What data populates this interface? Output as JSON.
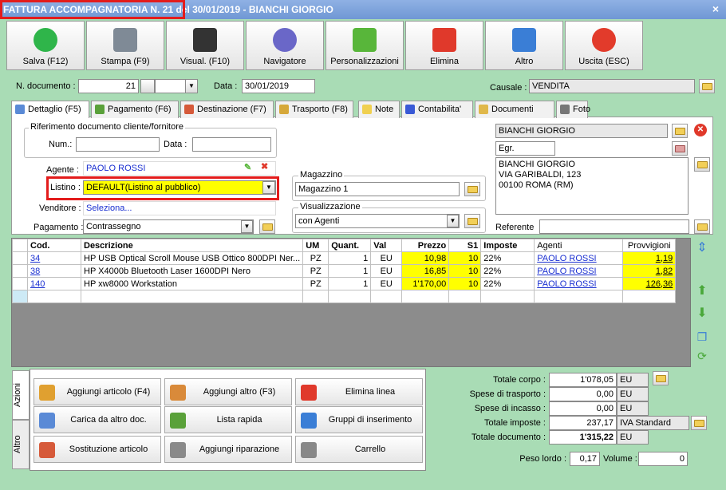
{
  "window": {
    "title": "FATTURA ACCOMPAGNATORIA N. 21 del 30/01/2019 - BIANCHI GIORGIO",
    "close": "×"
  },
  "toolbar": [
    {
      "label": "Salva (F12)",
      "icon": "check-icon",
      "color": "#2fb54a"
    },
    {
      "label": "Stampa (F9)",
      "icon": "printer-icon",
      "color": "#7f8a96"
    },
    {
      "label": "Visual. (F10)",
      "icon": "magic-wand-icon",
      "color": "#333333"
    },
    {
      "label": "Navigatore",
      "icon": "compass-icon",
      "color": "#6a67c8"
    },
    {
      "label": "Personalizzazioni",
      "icon": "puzzle-icon",
      "color": "#58b63a"
    },
    {
      "label": "Elimina",
      "icon": "delete-x-icon",
      "color": "#e0392b"
    },
    {
      "label": "Altro",
      "icon": "magnifier-icon",
      "color": "#3a7ed6"
    },
    {
      "label": "Uscita (ESC)",
      "icon": "exit-icon",
      "color": "#e23b2b"
    }
  ],
  "header": {
    "doc_label": "N. documento :",
    "doc_number": "21",
    "date_label": "Data :",
    "date": "30/01/2019",
    "causale_label": "Causale :",
    "causale": "VENDITA"
  },
  "tabs": [
    {
      "label": "Dettaglio (F5)",
      "icon": "detail-icon",
      "color": "#5a8ad6"
    },
    {
      "label": "Pagamento (F6)",
      "icon": "payment-icon",
      "color": "#5aa13a"
    },
    {
      "label": "Destinazione (F7)",
      "icon": "destination-icon",
      "color": "#d65a3a"
    },
    {
      "label": "Trasporto (F8)",
      "icon": "truck-icon",
      "color": "#d6a83a"
    },
    {
      "label": "Note",
      "icon": "note-icon",
      "color": "#f0d050"
    },
    {
      "label": "Contabilita'",
      "icon": "book-icon",
      "color": "#3a5ad6"
    },
    {
      "label": "Documenti",
      "icon": "documents-icon",
      "color": "#e0b84a"
    },
    {
      "label": "Foto",
      "icon": "camera-icon",
      "color": "#777777"
    }
  ],
  "riferimento": {
    "title": "Riferimento documento cliente/fornitore",
    "num_label": "Num.:",
    "data_label": "Data :"
  },
  "agente": {
    "label": "Agente :",
    "value": "PAOLO ROSSI"
  },
  "listino": {
    "label": "Listino :",
    "value": "DEFAULT(Listino al pubblico)"
  },
  "venditore": {
    "label": "Venditore :",
    "value": "Seleziona..."
  },
  "pagamento": {
    "label": "Pagamento :",
    "value": "Contrassegno"
  },
  "magazzino": {
    "title": "Magazzino",
    "value": "Magazzino 1"
  },
  "visualizzazione": {
    "title": "Visualizzazione",
    "value": "con Agenti"
  },
  "cliente": {
    "name": "BIANCHI GIORGIO",
    "code": "Egr.",
    "address": [
      "BIANCHI GIORGIO",
      "VIA GARIBALDI, 123",
      "00100 ROMA (RM)"
    ],
    "referente_label": "Referente"
  },
  "grid": {
    "columns": [
      "Cod.",
      "Descrizione",
      "UM",
      "Quant.",
      "Val",
      "Prezzo",
      "S1",
      "Imposte",
      "Agenti",
      "Provvigioni"
    ],
    "rows": [
      [
        "34",
        "HP USB Optical Scroll Mouse USB Ottico 800DPI Ner...",
        "PZ",
        "1",
        "EU",
        "10,98",
        "10",
        "22%",
        "PAOLO ROSSI",
        "1,19"
      ],
      [
        "38",
        "HP X4000b Bluetooth Laser 1600DPI Nero",
        "PZ",
        "1",
        "EU",
        "16,85",
        "10",
        "22%",
        "PAOLO ROSSI",
        "1,82"
      ],
      [
        "140",
        "HP xw8000 Workstation",
        "PZ",
        "1",
        "EU",
        "1'170,00",
        "10",
        "22%",
        "PAOLO ROSSI",
        "126,36"
      ]
    ]
  },
  "actions": {
    "vtabs": [
      "Azioni",
      "Altro"
    ],
    "buttons": [
      {
        "label": "Aggiungi articolo (F4)",
        "icon": "add-article-icon",
        "color": "#e0a030"
      },
      {
        "label": "Aggiungi altro (F3)",
        "icon": "add-other-icon",
        "color": "#d98a3a"
      },
      {
        "label": "Elimina linea",
        "icon": "delete-line-icon",
        "color": "#e0392b"
      },
      {
        "label": "Carica da altro doc.",
        "icon": "load-doc-icon",
        "color": "#5a8ad6"
      },
      {
        "label": "Lista rapida",
        "icon": "quick-list-icon",
        "color": "#5aa13a"
      },
      {
        "label": "Gruppi di inserimento",
        "icon": "groups-icon",
        "color": "#3a7ed6"
      },
      {
        "label": "Sostituzione articolo",
        "icon": "replace-article-icon",
        "color": "#d65a3a"
      },
      {
        "label": "Aggiungi riparazione",
        "icon": "wrench-icon",
        "color": "#8a8a8a"
      },
      {
        "label": "Carrello",
        "icon": "cart-icon",
        "color": "#888888"
      }
    ]
  },
  "totals": {
    "corpo": {
      "label": "Totale corpo :",
      "value": "1'078,05",
      "cur": "EU"
    },
    "trasporto": {
      "label": "Spese di trasporto :",
      "value": "0,00",
      "cur": "EU"
    },
    "incasso": {
      "label": "Spese di incasso :",
      "value": "0,00",
      "cur": "EU"
    },
    "imposte": {
      "label": "Totale imposte :",
      "value": "237,17",
      "cur": "IVA Standard"
    },
    "documento": {
      "label": "Totale documento :",
      "value": "1'315,22",
      "cur": "EU"
    },
    "peso": {
      "label": "Peso lordo :",
      "value": "0,17"
    },
    "volume": {
      "label": "Volume :",
      "value": "0"
    }
  }
}
